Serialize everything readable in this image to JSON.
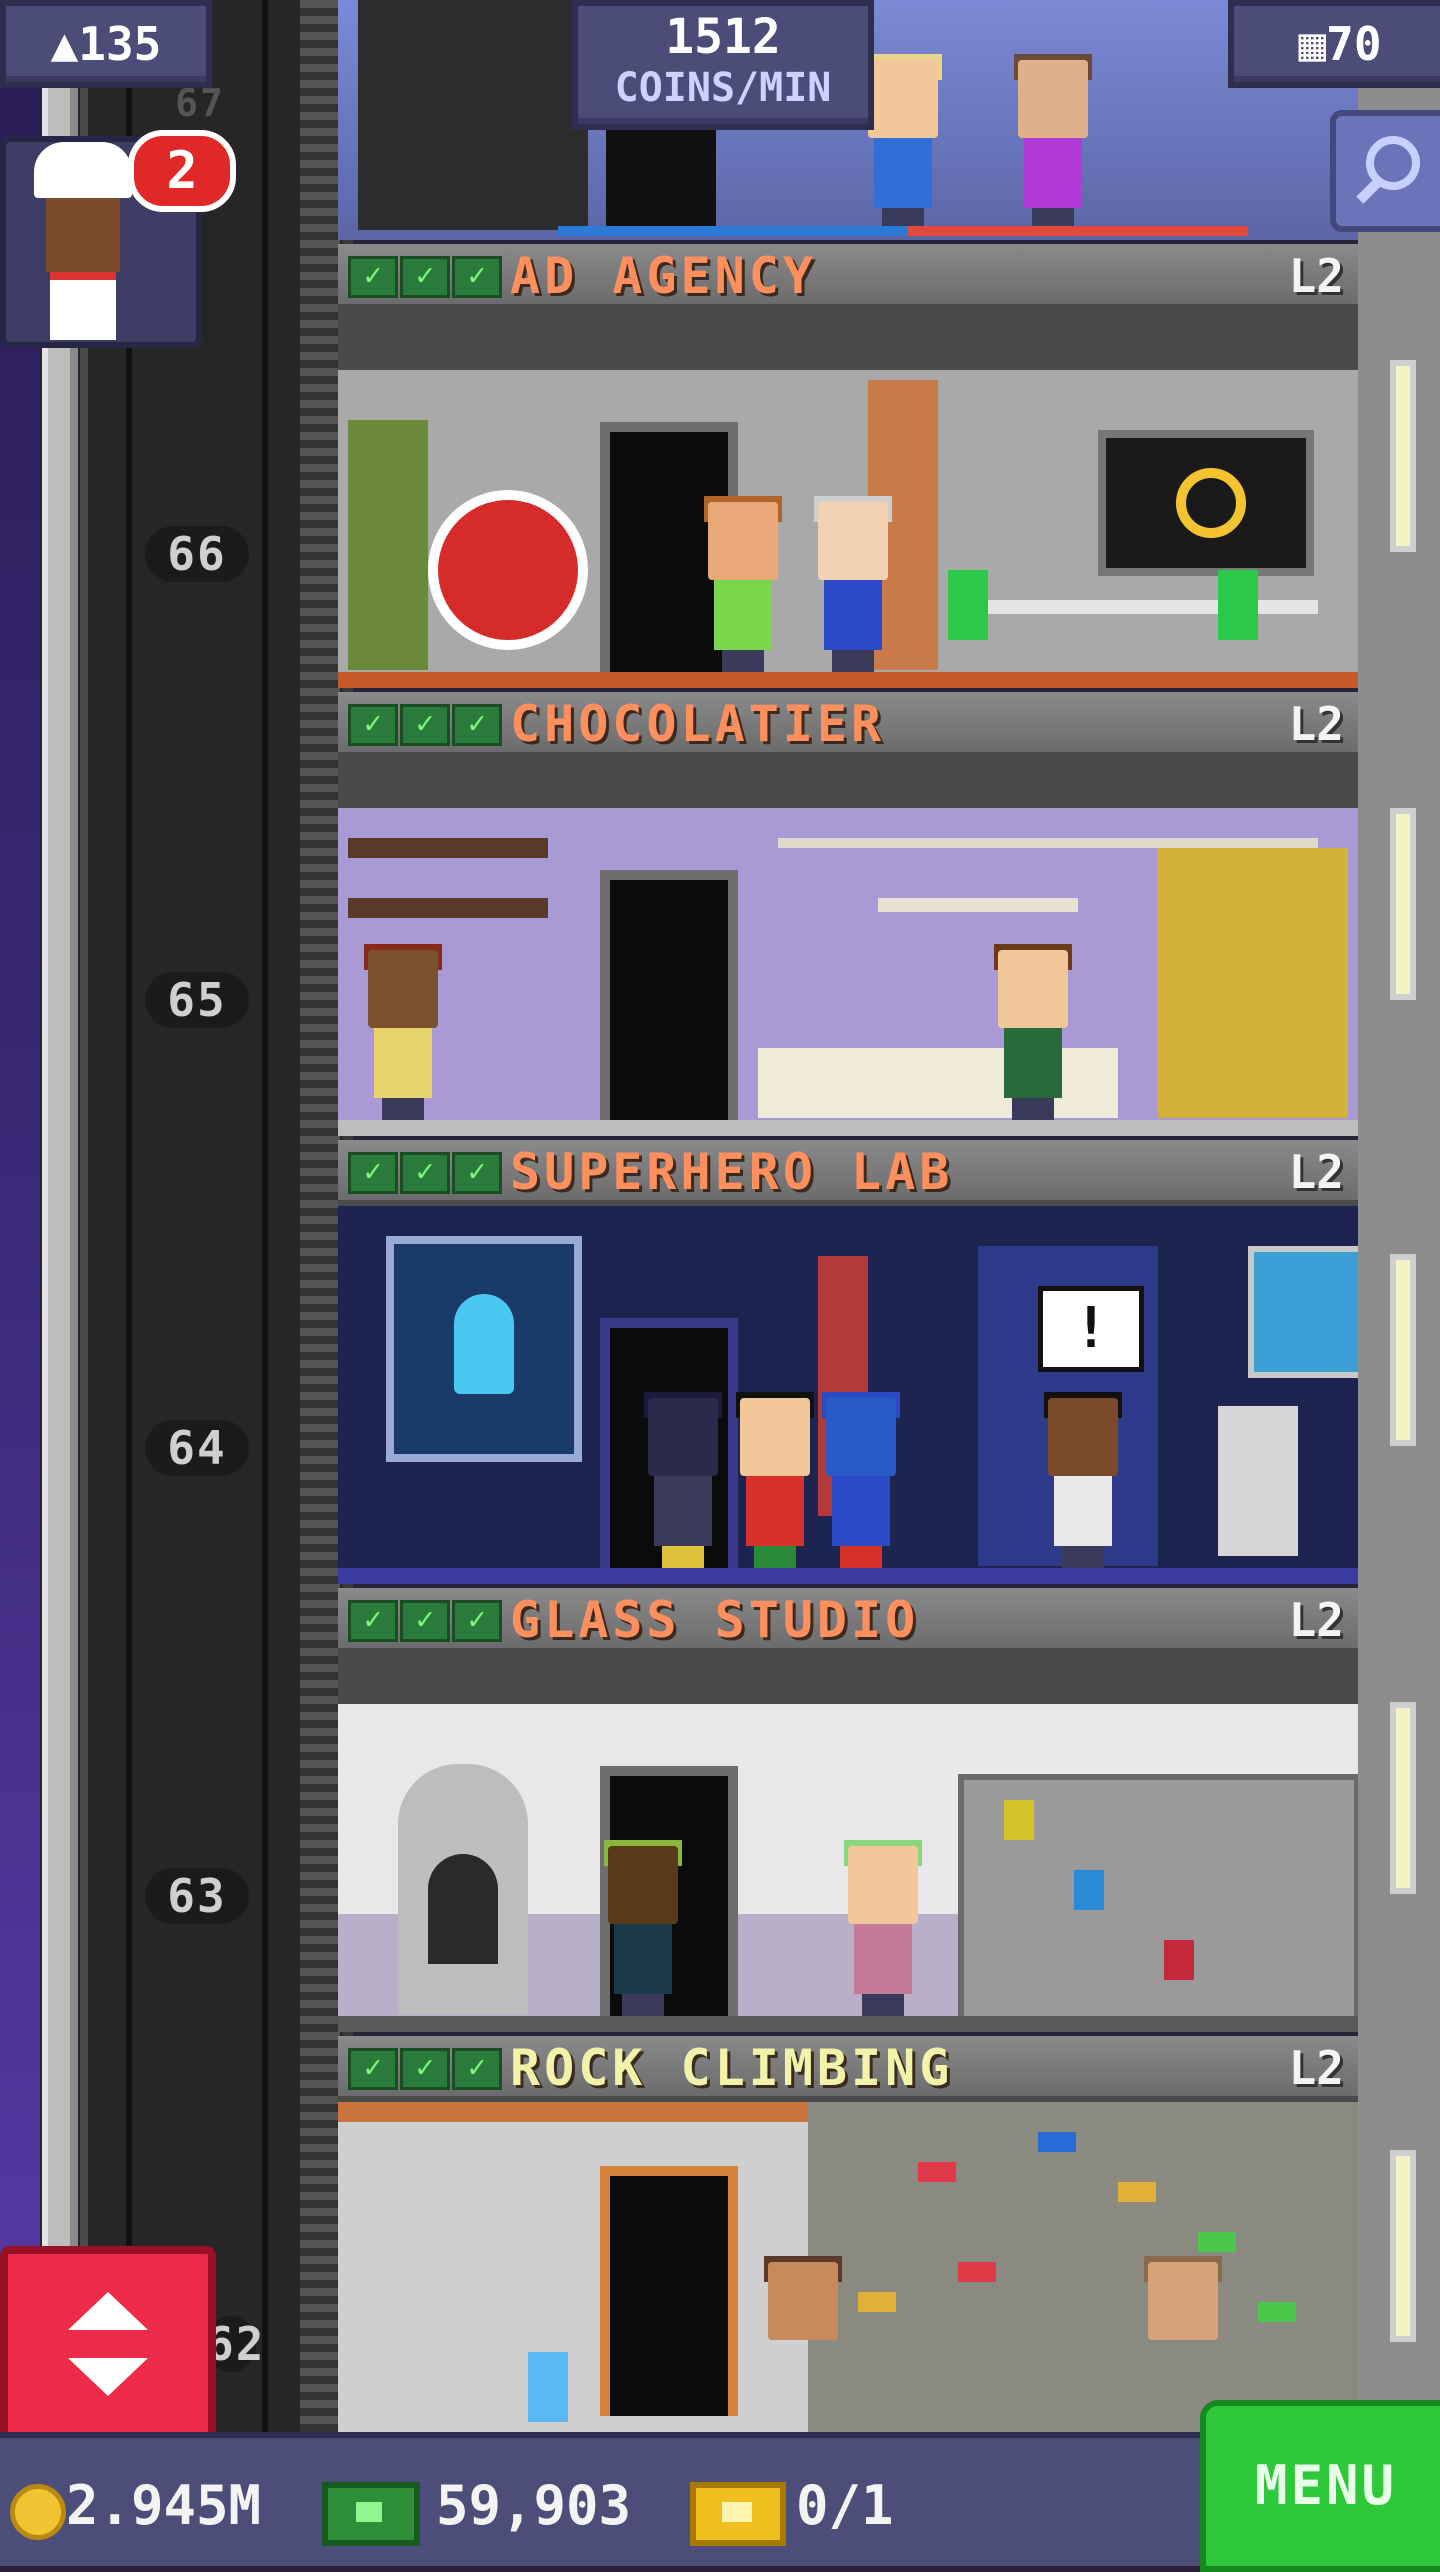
{
  "top_bar": {
    "population": "135",
    "population_icon": "person-icon",
    "coins_per_min_value": "1512",
    "coins_per_min_label": "COINS/MIN",
    "floor_count": "70",
    "floor_count_icon": "building-icon",
    "search_icon": "magnifier-icon"
  },
  "worker_notification": {
    "worker_icon": "chef-icon",
    "badge_count": "2"
  },
  "shaft_floor_numbers": [
    "67",
    "66",
    "65",
    "64",
    "63",
    "62"
  ],
  "floors": [
    {
      "name": "AD AGENCY",
      "level": "L2",
      "checks": 3,
      "name_color": "#ff8f5c"
    },
    {
      "name": "CHOCOLATIER",
      "level": "L2",
      "checks": 3,
      "name_color": "#ff8f5c"
    },
    {
      "name": "SUPERHERO LAB",
      "level": "L2",
      "checks": 3,
      "name_color": "#ff8f5c"
    },
    {
      "name": "GLASS STUDIO",
      "level": "L2",
      "checks": 3,
      "name_color": "#ff8f5c"
    },
    {
      "name": "ROCK CLIMBING",
      "level": "L2",
      "checks": 3,
      "name_color": "#f2f2a8"
    }
  ],
  "speech_bubble": "!",
  "bottom_bar": {
    "coins": "2.945M",
    "tower_bux": "59,903",
    "tickets": "0/1",
    "menu_label": "MENU"
  },
  "colors": {
    "menu_green": "#2ec83a",
    "elevator_red": "#ee2c4a",
    "badge_red": "#e02828",
    "floor_name_orange": "#ff8f5c"
  }
}
